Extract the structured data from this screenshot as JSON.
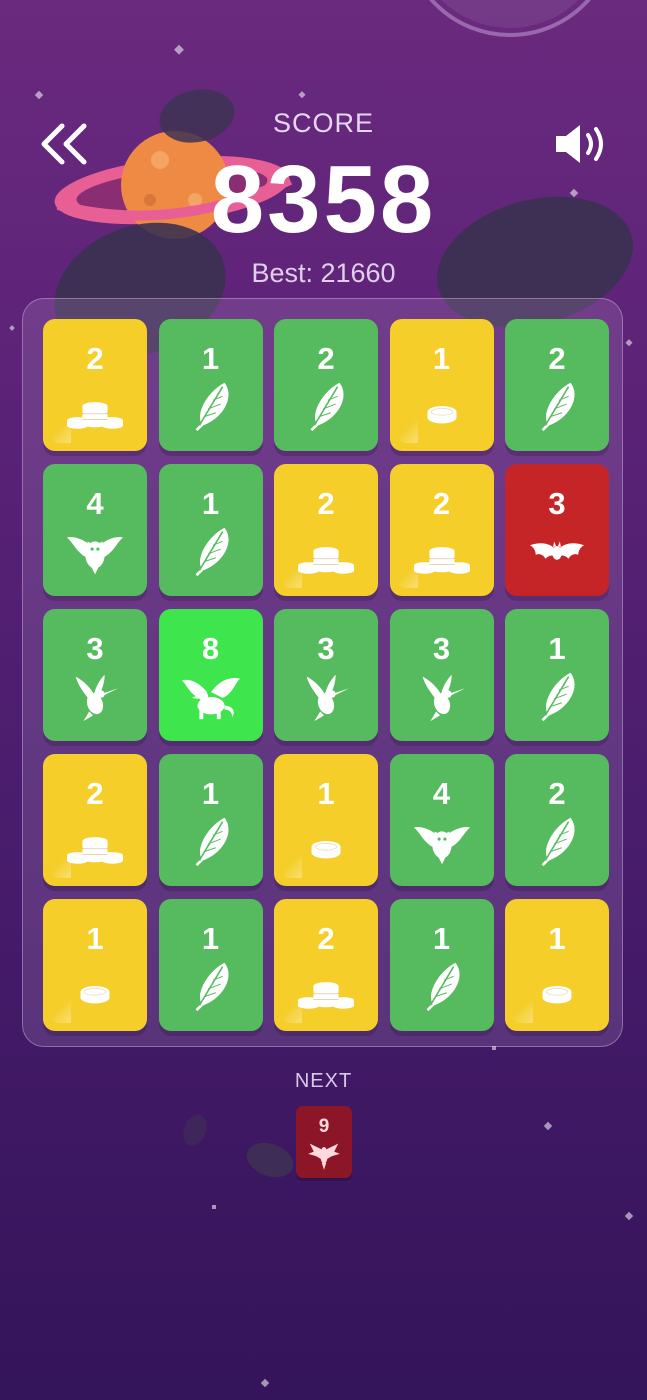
{
  "header": {
    "back_icon": "double-chevron-left-icon",
    "sound_icon": "speaker-volume-icon",
    "score_label": "SCORE",
    "score_value": "8358",
    "best_text": "Best: 21660"
  },
  "board": {
    "rows": [
      [
        {
          "value": "2",
          "color": "yellow",
          "icon": "coins"
        },
        {
          "value": "1",
          "color": "green",
          "icon": "feather"
        },
        {
          "value": "2",
          "color": "green",
          "icon": "feather"
        },
        {
          "value": "1",
          "color": "yellow",
          "icon": "coin"
        },
        {
          "value": "2",
          "color": "green",
          "icon": "feather"
        }
      ],
      [
        {
          "value": "4",
          "color": "green",
          "icon": "owl"
        },
        {
          "value": "1",
          "color": "green",
          "icon": "feather"
        },
        {
          "value": "2",
          "color": "yellow",
          "icon": "coins"
        },
        {
          "value": "2",
          "color": "yellow",
          "icon": "coins"
        },
        {
          "value": "3",
          "color": "red",
          "icon": "bat"
        }
      ],
      [
        {
          "value": "3",
          "color": "green",
          "icon": "hummingbird"
        },
        {
          "value": "8",
          "color": "lime",
          "icon": "griffin"
        },
        {
          "value": "3",
          "color": "green",
          "icon": "hummingbird"
        },
        {
          "value": "3",
          "color": "green",
          "icon": "hummingbird"
        },
        {
          "value": "1",
          "color": "green",
          "icon": "feather"
        }
      ],
      [
        {
          "value": "2",
          "color": "yellow",
          "icon": "coins"
        },
        {
          "value": "1",
          "color": "green",
          "icon": "feather"
        },
        {
          "value": "1",
          "color": "yellow",
          "icon": "coin"
        },
        {
          "value": "4",
          "color": "green",
          "icon": "owl"
        },
        {
          "value": "2",
          "color": "green",
          "icon": "feather"
        }
      ],
      [
        {
          "value": "1",
          "color": "yellow",
          "icon": "coin"
        },
        {
          "value": "1",
          "color": "green",
          "icon": "feather"
        },
        {
          "value": "2",
          "color": "yellow",
          "icon": "coins"
        },
        {
          "value": "1",
          "color": "green",
          "icon": "feather"
        },
        {
          "value": "1",
          "color": "yellow",
          "icon": "coin"
        }
      ]
    ]
  },
  "next": {
    "label": "NEXT",
    "value": "9",
    "color": "dark-red",
    "icon": "phoenix"
  },
  "colors": {
    "yellow": "#f5ce2a",
    "green": "#56bb5e",
    "lime": "#3fe54d",
    "red": "#c52527",
    "next": "#8c1628"
  }
}
